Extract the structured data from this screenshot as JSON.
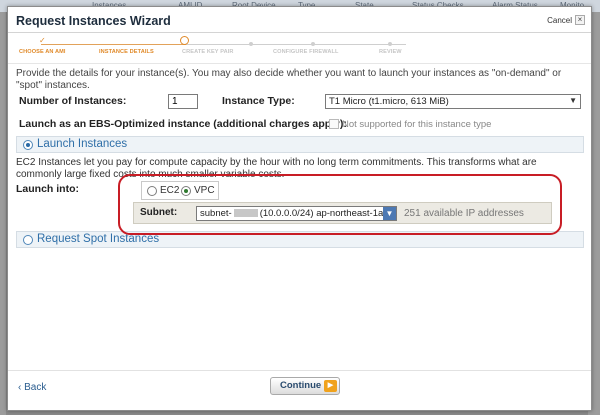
{
  "background": {
    "columns": [
      "Instances",
      "AMI ID",
      "Root Device",
      "Type",
      "State",
      "Status Checks",
      "Alarm Status",
      "Monito"
    ]
  },
  "modal": {
    "title": "Request Instances Wizard",
    "cancel_label": "Cancel",
    "close_glyph": "×"
  },
  "steps": [
    {
      "label": "CHOOSE AN AMI",
      "status": "done"
    },
    {
      "label": "INSTANCE DETAILS",
      "status": "current"
    },
    {
      "label": "CREATE KEY PAIR",
      "status": "todo"
    },
    {
      "label": "CONFIGURE FIREWALL",
      "status": "todo"
    },
    {
      "label": "REVIEW",
      "status": "todo"
    }
  ],
  "intro": "Provide the details for your instance(s). You may also decide whether you want to launch your instances as \"on-demand\" or \"spot\" instances.",
  "form": {
    "num_instances_label": "Number of Instances:",
    "num_instances_value": "1",
    "instance_type_label": "Instance Type:",
    "instance_type_value": "T1 Micro (t1.micro, 613 MiB)",
    "ebs_label": "Launch as an EBS-Optimized instance (additional charges apply):",
    "ebs_note": "Not supported for this instance type"
  },
  "launch": {
    "section_label": "Launch Instances",
    "description": "EC2 Instances let you pay for compute capacity by the hour with no long term commitments. This transforms what are commonly large fixed costs into much smaller variable costs.",
    "launch_into_label": "Launch into:",
    "options": [
      "EC2",
      "VPC"
    ],
    "selected": "VPC",
    "subnet_label": "Subnet:",
    "subnet_prefix": "subnet-",
    "subnet_suffix": "(10.0.0.0/24) ap-northeast-1a",
    "available_ips": "251 available IP addresses"
  },
  "spot": {
    "section_label": "Request Spot Instances"
  },
  "footer": {
    "back_label": "‹ Back",
    "continue_label": "Continue",
    "continue_glyph": "▶"
  },
  "colors": {
    "accent_orange": "#e08a2a",
    "section_blue": "#2f6fa8",
    "highlight_red": "#c81d25"
  }
}
